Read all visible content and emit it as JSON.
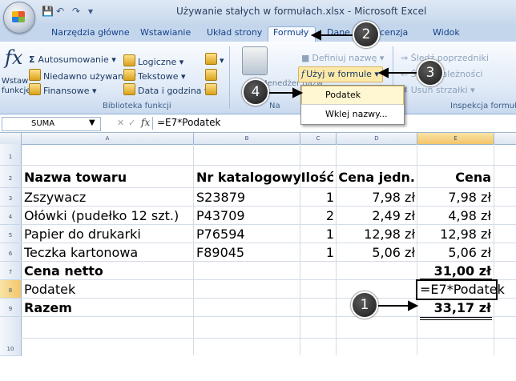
{
  "window": {
    "title": "Używanie stałych w formułach.xlsx - Microsoft Excel"
  },
  "tabs": [
    "Narzędzia główne",
    "Wstawianie",
    "Układ strony",
    "Formuły",
    "Dane",
    "Recenzja",
    "Widok"
  ],
  "ribbon": {
    "insert_function": "Wstaw funkcję",
    "insert_function_line1": "Wstaw",
    "insert_function_line2": "funkcję",
    "autosum": "Autosumowanie",
    "recent": "Niedawno używane",
    "financial": "Finansowe",
    "logical": "Logiczne",
    "text": "Tekstowe",
    "datetime": "Data i godzina",
    "library_label": "Biblioteka funkcji",
    "name_manager": "Menedżer nazw",
    "define_name": "Definiuj nazwę",
    "use_in_formula": "Użyj w formule",
    "trace_precedents": "Śledź poprzedniki",
    "trace_dependents": "Śledź zależności",
    "remove_arrows": "Usuń strzałki",
    "auditing_label": "Inspekcja formuł"
  },
  "dropdown": {
    "items": [
      "Podatek",
      "Wklej nazwy..."
    ]
  },
  "formula_bar": {
    "name_box": "SUMA",
    "fx": "fx",
    "formula": "=E7*Podatek"
  },
  "columns": [
    "A",
    "B",
    "C",
    "D",
    "E"
  ],
  "rows": [
    "1",
    "2",
    "3",
    "4",
    "5",
    "6",
    "7",
    "8",
    "9",
    "10"
  ],
  "table": {
    "headers": [
      "Nazwa towaru",
      "Nr katalogowy",
      "Ilość",
      "Cena jedn.",
      "Cena"
    ],
    "rows": [
      [
        "Zszywacz",
        "S23879",
        "1",
        "7,98 zł",
        "7,98 zł"
      ],
      [
        "Ołówki (pudełko 12 szt.)",
        "P43709",
        "2",
        "2,49 zł",
        "4,98 zł"
      ],
      [
        "Papier do drukarki",
        "P76594",
        "1",
        "12,98 zł",
        "12,98 zł"
      ],
      [
        "Teczka kartonowa",
        "F89045",
        "1",
        "5,06 zł",
        "5,06 zł"
      ]
    ],
    "net_label": "Cena netto",
    "net_value": "31,00 zł",
    "tax_label": "Podatek",
    "tax_value": "=E7*Podatek",
    "total_label": "Razem",
    "total_value": "33,17 zł"
  },
  "callouts": [
    "1",
    "2",
    "3",
    "4"
  ],
  "colors": {
    "ribbon_bg": "#dde8f6",
    "tab_text": "#15428b",
    "callout": "#1a1a1a"
  }
}
